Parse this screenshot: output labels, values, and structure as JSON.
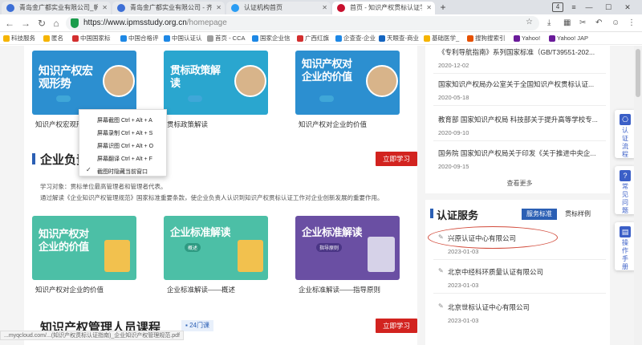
{
  "browser": {
    "tabs": [
      {
        "title": "青岛金广都实业有限公司_帆",
        "active": false
      },
      {
        "title": "青岛金广都实业有限公司 - 齐",
        "active": false
      },
      {
        "title": "认证机构首页",
        "active": false
      },
      {
        "title": "首页 - 知识产权贯标认证学习",
        "active": true
      }
    ],
    "url_host": "https://www.ipmsstudy.org.cn",
    "url_path": "/homepage",
    "tab_count": "4",
    "bookmarks": [
      "科技服务",
      "匿名",
      "中国国家标",
      "中国合格评",
      "中国认证认",
      "首页 - CCA",
      "国家企业信",
      "广西红旗",
      "企查查-企业",
      "天眼查-商业",
      "基础医学_",
      "搜狗搜索引",
      "Yahoo!",
      "Yahoo! JAP"
    ]
  },
  "main": {
    "course_row1": [
      {
        "thumb_title": "知识产权宏观形势",
        "caption": "知识产权宏观形势",
        "thumb_color": "#2c8fd0"
      },
      {
        "thumb_title": "贯标政策解读",
        "caption": "贯标政策解读",
        "thumb_color": "#2aa6cf"
      },
      {
        "thumb_title": "知识产权对企业的价值",
        "caption": "知识产权对企业的价值",
        "thumb_color": "#2c8fd0"
      }
    ],
    "section1": {
      "title": "企业负责人",
      "button": "立即学习"
    },
    "learning_target": "学习对象：贯标单位最高管理者和管理者代表。",
    "learning_desc": "通过解读《企业知识产权管理规范》国家标准重要条款，使企业负责人认识到知识产权贯标认证工作对企业创新发展的重要作用。",
    "course_row2": [
      {
        "thumb_title": "知识产权对企业的价值",
        "caption": "知识产权对企业的价值",
        "thumb_color": "#4cbfa6"
      },
      {
        "thumb_title": "企业标准解读",
        "sub": "概述",
        "caption": "企业标准解读——概述",
        "thumb_color": "#4cbfa6"
      },
      {
        "thumb_title": "企业标准解读",
        "sub": "指导原则",
        "caption": "企业标准解读——指导原则",
        "thumb_color": "#6a4fa3"
      }
    ],
    "section2": {
      "title": "知识产权管理人员课程",
      "badge": "24门课",
      "button": "立即学习"
    },
    "context_menu": [
      {
        "label": "屏幕截图 Ctrl + Alt + A",
        "checked": false
      },
      {
        "label": "屏幕录制 Ctrl + Alt + S",
        "checked": false
      },
      {
        "label": "屏幕识图 Ctrl + Alt + O",
        "checked": false
      },
      {
        "label": "屏幕翻译 Ctrl + Alt + F",
        "checked": false
      },
      {
        "label": "截图时隐藏当前窗口",
        "checked": true
      }
    ]
  },
  "sidebar": {
    "news": [
      {
        "title": "《专利导航指南》系列国家标准（GB/T39551-202...",
        "date": "2020-12-02"
      },
      {
        "title": "国家知识产权局办公室关于全国知识产权贯标认证...",
        "date": "2020-05-18"
      },
      {
        "title": "教育部 国家知识产权局 科技部关于提升高等学校专...",
        "date": "2020-09-10"
      },
      {
        "title": "国务院 国家知识产权局关于印发《关于推进中央企...",
        "date": "2020-09-15"
      }
    ],
    "more": "查看更多",
    "cert_title": "认证服务",
    "cert_tabs": [
      "服务标准",
      "贯标样例"
    ],
    "cert_list": [
      {
        "name": "兴原认证中心有限公司",
        "date": "2023-01-03"
      },
      {
        "name": "北京中经科环质量认证有限公司",
        "date": "2023-01-03"
      },
      {
        "name": "北京世标认证中心有限公司",
        "date": "2023-01-03"
      }
    ]
  },
  "float_panel": [
    {
      "label": "认证流程",
      "icon": "flow-icon"
    },
    {
      "label": "常见问题",
      "icon": "question-icon"
    },
    {
      "label": "操作手册",
      "icon": "manual-icon"
    }
  ],
  "status_text": "...myqcloud.com/...(知识产权贯标认证指南)_企业知识产权管理规范.pdf"
}
